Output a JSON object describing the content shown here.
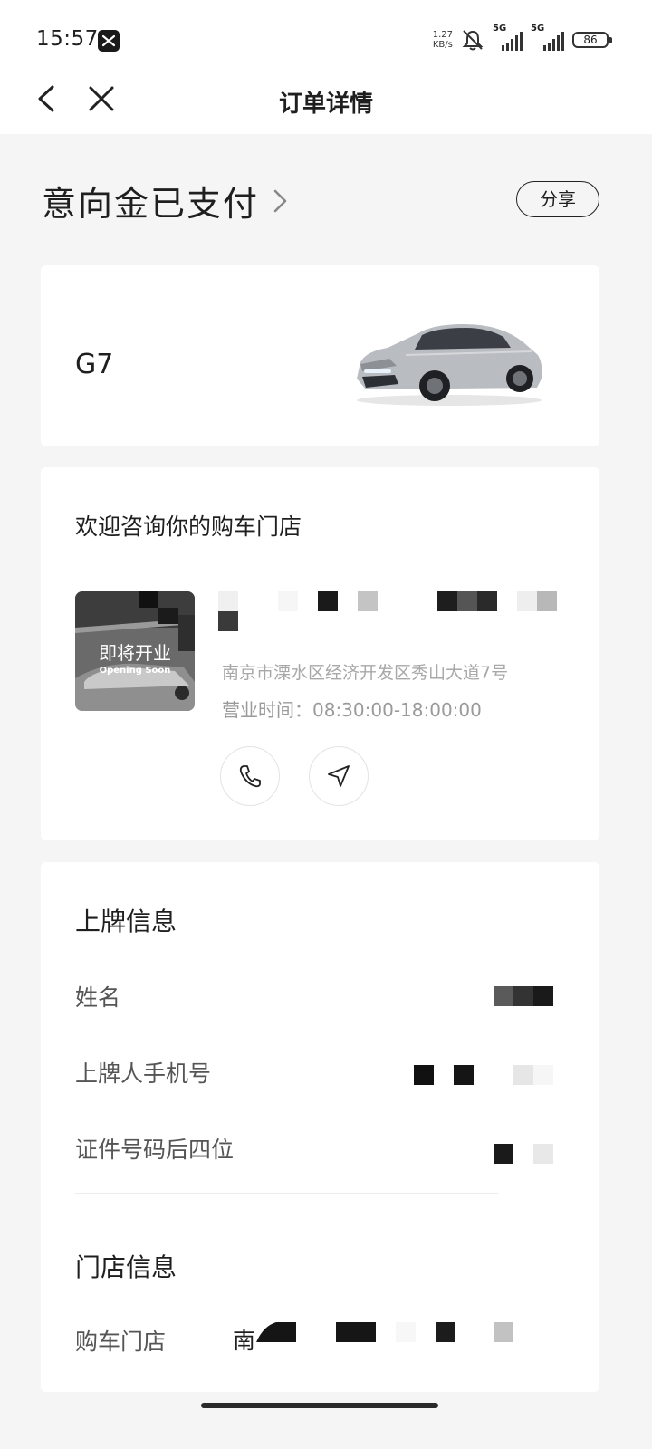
{
  "status_bar": {
    "time": "15:57",
    "net_speed_value": "1.27",
    "net_speed_unit": "KB/s",
    "signal_1_label": "5G",
    "signal_2_label": "5G",
    "battery": "86"
  },
  "nav": {
    "title": "订单详情",
    "back_icon": "back-arrow-icon",
    "close_icon": "close-icon"
  },
  "order": {
    "status": "意向金已支付",
    "share_label": "分享"
  },
  "vehicle": {
    "model": "G7"
  },
  "store_section": {
    "heading": "欢迎咨询你的购车门店",
    "thumb_title": "即将开业",
    "thumb_subtitle": "Opening Soon",
    "address": "南京市溧水区经济开发区秀山大道7号",
    "hours": "营业时间：08:30:00-18:00:00",
    "phone_icon": "phone-icon",
    "navigate_icon": "navigate-icon"
  },
  "plate_info": {
    "heading": "上牌信息",
    "rows": [
      {
        "label": "姓名"
      },
      {
        "label": "上牌人手机号"
      },
      {
        "label": "证件号码后四位"
      }
    ]
  },
  "store_info": {
    "heading": "门店信息",
    "rows": [
      {
        "label": "购车门店",
        "value_prefix": "南"
      }
    ]
  },
  "colors": {
    "background": "#f5f5f5",
    "card": "#ffffff",
    "primary_text": "#1f1f1f",
    "secondary_text": "#555555",
    "muted_text": "#a8a8a8"
  }
}
